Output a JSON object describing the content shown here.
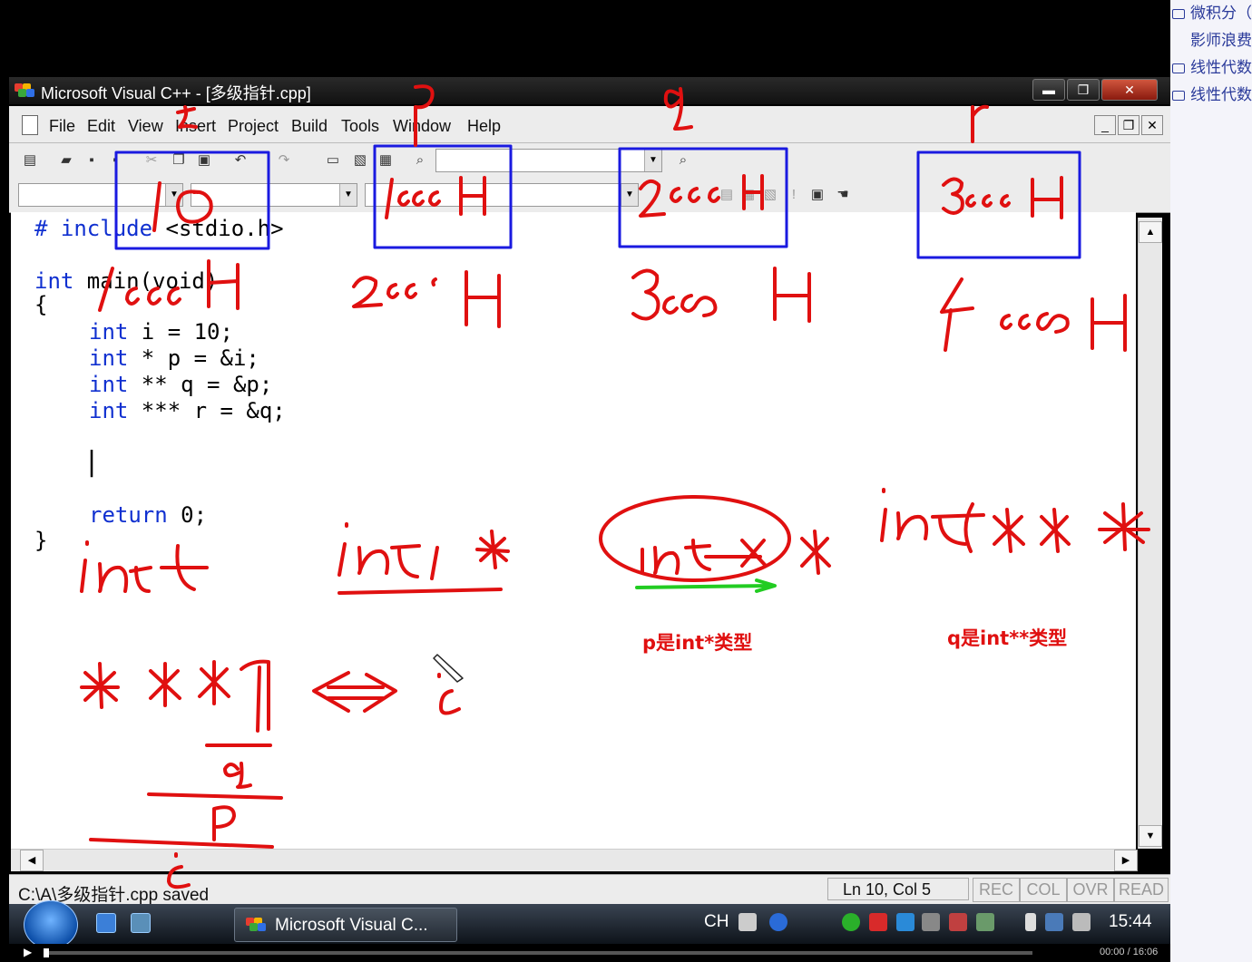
{
  "side_panel": {
    "items": [
      {
        "label": "微积分（",
        "folder": true
      },
      {
        "label": "影师浪费",
        "folder": false
      },
      {
        "label": "线性代数",
        "folder": true
      },
      {
        "label": "线性代数",
        "folder": true
      }
    ]
  },
  "window": {
    "title": "Microsoft Visual C++ - [多级指针.cpp]",
    "controls": {
      "minimize": "▬",
      "restore": "❐",
      "close": "✕"
    },
    "mdi_controls": {
      "minimize": "_",
      "restore": "❐",
      "close": "✕"
    }
  },
  "menubar": [
    "File",
    "Edit",
    "View",
    "Insert",
    "Project",
    "Build",
    "Tools",
    "Window",
    "Help"
  ],
  "code": {
    "include_kw": "# include",
    "include_rest": " <stdio.h>",
    "main_kw": "int",
    "main_rest": " main(void)",
    "open_brace": "{",
    "lines": [
      {
        "kw": "int",
        "rest": " i = 10;"
      },
      {
        "kw": "int",
        "rest": " * p = &i;"
      },
      {
        "kw": "int",
        "rest": " ** q = &p;"
      },
      {
        "kw": "int",
        "rest": " *** r = &q;"
      }
    ],
    "cursor": "|",
    "return_kw": "return",
    "return_rest": " 0;",
    "close_brace": "}"
  },
  "annotations": {
    "captions": [
      "p是int*类型",
      "q是int**类型"
    ]
  },
  "statusbar": {
    "message": "C:\\A\\多级指针.cpp saved",
    "position": "Ln 10, Col 5",
    "indicators": [
      "REC",
      "COL",
      "OVR",
      "READ"
    ]
  },
  "taskbar": {
    "app_label": "Microsoft Visual C...",
    "lang": "CH",
    "time": "15:44"
  },
  "player": {
    "time": "00:00 / 16:06"
  },
  "colors": {
    "ink_red": "#e01010",
    "ink_blue": "#1a1ae0",
    "ink_green": "#22cc22",
    "keyword": "#1030d0"
  }
}
